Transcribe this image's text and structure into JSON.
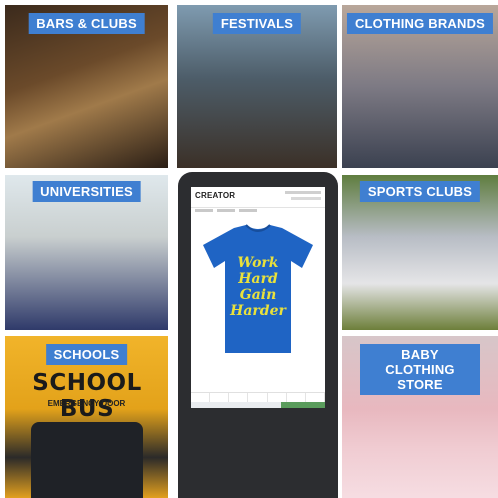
{
  "tiles": {
    "bars_clubs": "BARS & CLUBS",
    "festivals": "FESTIVALS",
    "clothing_brands": "CLOTHING BRANDS",
    "universities": "UNIVERSITIES",
    "sports_clubs": "SPORTS CLUBS",
    "schools": "SCHOOLS",
    "baby_clothing_store": "BABY CLOTHING STORE"
  },
  "bus": {
    "sign": "SCHOOL BUS",
    "door": "EMERGENCY DOOR"
  },
  "kiosk": {
    "logo": "CREATOR",
    "shirt_text": [
      "Work",
      "Hard",
      "Gain",
      "Harder"
    ]
  },
  "colors": {
    "label_bg": "#3f7fd1",
    "shirt": "#1f64c4",
    "shirt_print": "#e9e13c",
    "kiosk_body": "#2c2d30"
  }
}
